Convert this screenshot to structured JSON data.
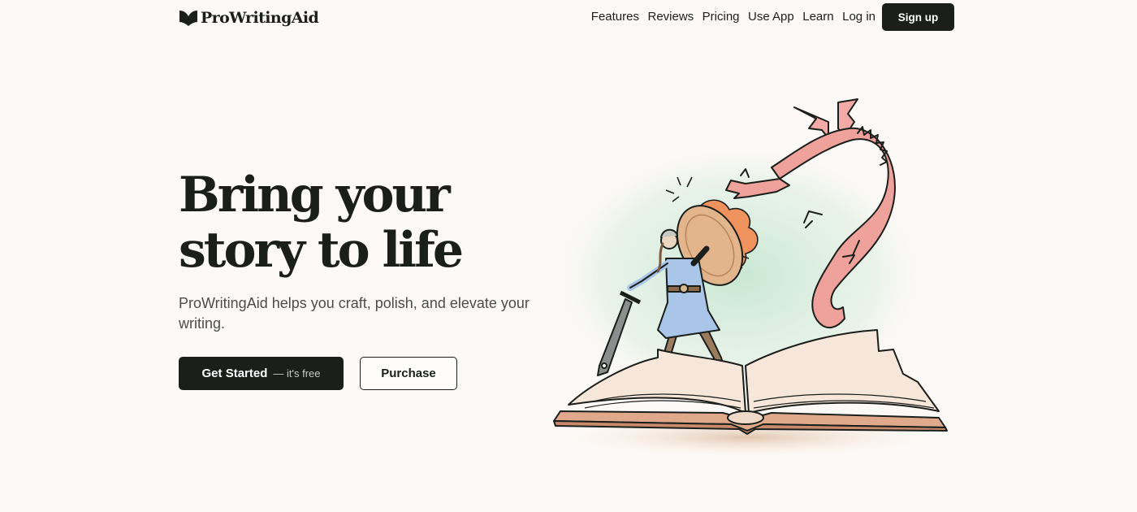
{
  "header": {
    "logo_text": "ProWritingAid",
    "logo_icon": "book-heart-icon",
    "nav": [
      {
        "label": "Features"
      },
      {
        "label": "Reviews"
      },
      {
        "label": "Pricing"
      },
      {
        "label": "Use App"
      },
      {
        "label": "Learn"
      },
      {
        "label": "Log in"
      }
    ],
    "signup_label": "Sign up"
  },
  "hero": {
    "title_line1": "Bring your",
    "title_line2": "story to life",
    "subtitle": "ProWritingAid helps you craft, polish, and elevate your writing.",
    "primary_cta": {
      "main": "Get Started",
      "extra": "— it's free"
    },
    "secondary_cta": "Purchase",
    "illustration": "knight-fighting-dragon-from-open-book"
  },
  "colors": {
    "background": "#fdf9f6",
    "ink": "#1b1f1c",
    "dragon": "#ee9b97",
    "knight_tunic": "#a9c6e8",
    "glow_green": "#cde9d7"
  }
}
